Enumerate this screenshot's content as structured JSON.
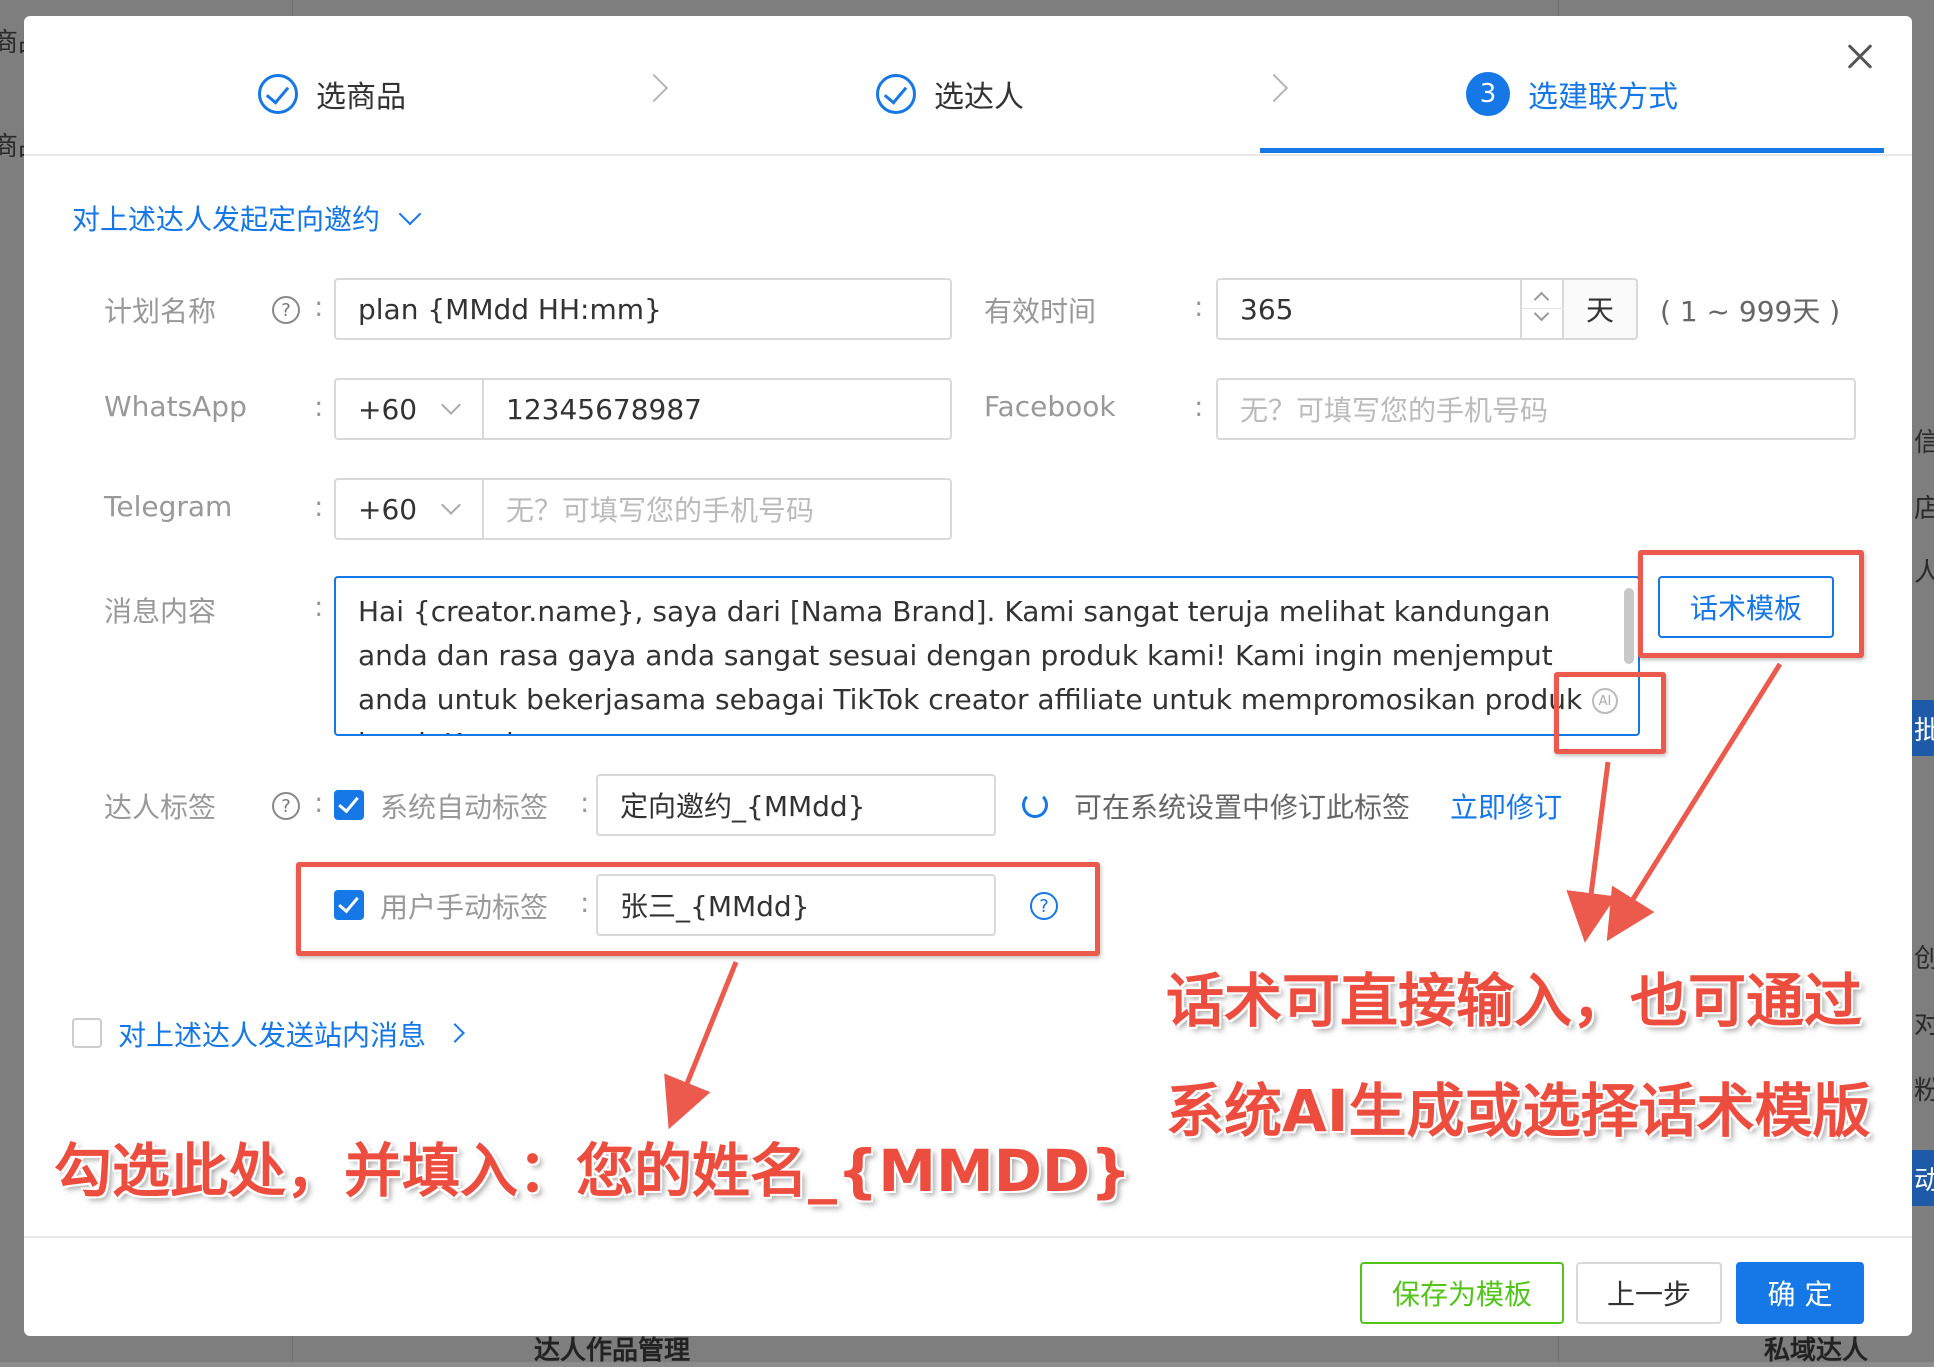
{
  "background": {
    "left_items": [
      "商品",
      "商品"
    ],
    "bottom_items": [
      "达人作品管理",
      "私域达人"
    ],
    "right_partial": [
      "信息",
      "店",
      "人",
      "批",
      "创",
      "对",
      "粉",
      "动"
    ]
  },
  "steps": [
    {
      "label": "选商品",
      "state": "done"
    },
    {
      "label": "选达人",
      "state": "done"
    },
    {
      "label": "选建联方式",
      "state": "active",
      "number": "3"
    }
  ],
  "section": {
    "title": "对上述达人发起定向邀约"
  },
  "form": {
    "plan_name": {
      "label": "计划名称",
      "value": "plan {MMdd HH:mm}"
    },
    "valid_time": {
      "label": "有效时间",
      "value": "365",
      "unit": "天",
      "range_hint": "( 1 ~ 999天 )"
    },
    "whatsapp": {
      "label": "WhatsApp",
      "code": "+60",
      "value": "12345678987"
    },
    "facebook": {
      "label": "Facebook",
      "placeholder": "无？可填写您的手机号码"
    },
    "telegram": {
      "label": "Telegram",
      "code": "+60",
      "placeholder": "无？可填写您的手机号码"
    },
    "message": {
      "label": "消息内容",
      "value": "Hai {creator.name}, saya dari [Nama Brand]. Kami sangat teruja melihat kandungan anda dan rasa gaya anda sangat sesuai dengan produk kami! Kami ingin menjemput anda untuk bekerjasama sebagai TikTok creator affiliate untuk mempromosikan produk kami. Kami",
      "template_button": "话术模板",
      "ai_icon_text": "AI"
    },
    "creator_tag": {
      "label": "达人标签",
      "auto_label": "系统自动标签",
      "auto_value": "定向邀约_{MMdd}",
      "auto_checked": true,
      "hint": "可在系统设置中修订此标签",
      "edit_link": "立即修订",
      "manual_label": "用户手动标签",
      "manual_value": "张三_{MMdd}",
      "manual_checked": true
    },
    "site_message": {
      "label": "对上述达人发送站内消息",
      "checked": false
    }
  },
  "footer": {
    "save_template": "保存为模板",
    "prev": "上一步",
    "confirm": "确 定"
  },
  "annotations": {
    "right_line1": "话术可直接输入，也可通过",
    "right_line2": "系统AI生成或选择话术模版",
    "left": "勾选此处，并填入：您的姓名_{MMDD}"
  },
  "colors": {
    "primary": "#1677e6",
    "annotation": "#ec4d3e",
    "save_green": "#52c41a"
  }
}
